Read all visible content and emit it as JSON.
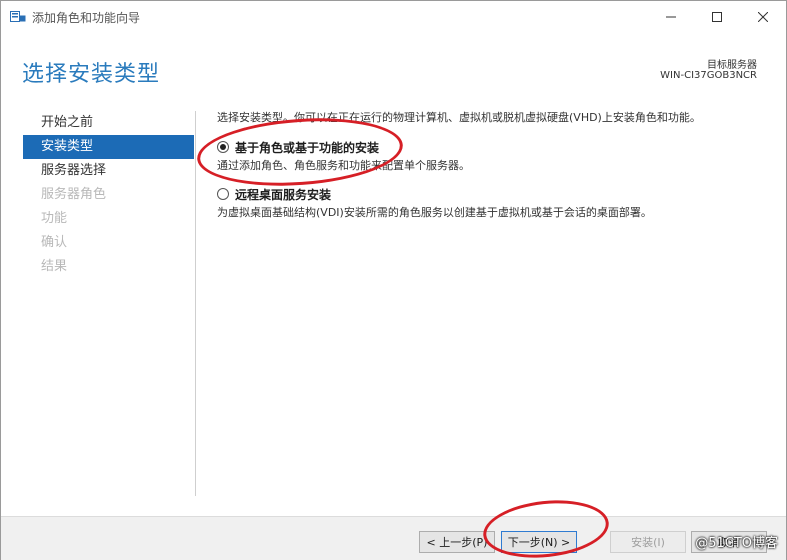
{
  "window": {
    "title": "添加角色和功能向导",
    "page_title": "选择安装类型",
    "target_label": "目标服务器",
    "target_name": "WIN-CI37GOB3NCR"
  },
  "nav": {
    "items": [
      {
        "label": "开始之前",
        "state": "normal"
      },
      {
        "label": "安装类型",
        "state": "active"
      },
      {
        "label": "服务器选择",
        "state": "normal"
      },
      {
        "label": "服务器角色",
        "state": "disabled"
      },
      {
        "label": "功能",
        "state": "disabled"
      },
      {
        "label": "确认",
        "state": "disabled"
      },
      {
        "label": "结果",
        "state": "disabled"
      }
    ]
  },
  "content": {
    "intro": "选择安装类型。你可以在正在运行的物理计算机、虚拟机或脱机虚拟硬盘(VHD)上安装角色和功能。",
    "options": [
      {
        "label": "基于角色或基于功能的安装",
        "desc": "通过添加角色、角色服务和功能来配置单个服务器。",
        "checked": true
      },
      {
        "label": "远程桌面服务安装",
        "desc": "为虚拟桌面基础结构(VDI)安装所需的角色服务以创建基于虚拟机或基于会话的桌面部署。",
        "checked": false
      }
    ]
  },
  "footer": {
    "prev": "< 上一步(P)",
    "next": "下一步(N) >",
    "install": "安装(I)",
    "cancel": "取消"
  },
  "watermark": "@51CTO博客",
  "colors": {
    "accent": "#1c6bb6",
    "title": "#2a7bbd",
    "annotation": "#d61f26"
  }
}
